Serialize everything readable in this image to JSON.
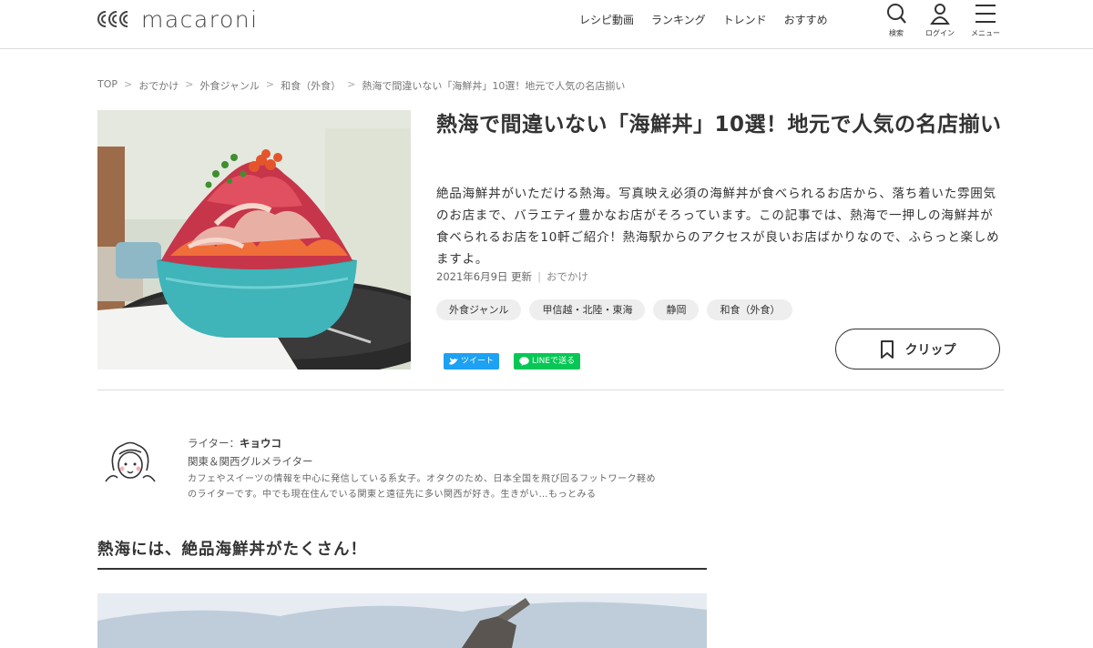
{
  "header": {
    "logo_text": "macaroni",
    "nav": [
      "レシピ動画",
      "ランキング",
      "トレンド",
      "おすすめ"
    ],
    "tools": {
      "search": "検索",
      "login": "ログイン",
      "menu": "メニュー"
    }
  },
  "breadcrumb": [
    "TOP",
    "おでかけ",
    "外食ジャンル",
    "和食（外食）",
    "熱海で間違いない「海鮮丼」10選！地元で人気の名店揃い"
  ],
  "article": {
    "title": "熱海で間違いない「海鮮丼」10選！地元で人気の名店揃い",
    "description": "絶品海鮮丼がいただける熱海。写真映え必須の海鮮丼が食べられるお店から、落ち着いた雰囲気のお店まで、バラエティ豊かなお店がそろっています。この記事では、熱海で一押しの海鮮丼が食べられるお店を10軒ご紹介！熱海駅からのアクセスが良いお店ばかりなので、ふらっと楽しめますよ。",
    "date": "2021年6月9日 更新",
    "category": "おでかけ",
    "tags": [
      "外食ジャンル",
      "甲信越・北陸・東海",
      "静岡",
      "和食（外食）"
    ],
    "clip_label": "クリップ",
    "tweet_label": "ツイート",
    "line_label": "LINEで送る"
  },
  "writer": {
    "label": "ライター：",
    "name": "キョウコ",
    "role": "関東＆関西グルメライター",
    "bio_line1": "カフェやスイーツの情報を中心に発信している系女子。オタクのため、日本全国を飛び回るフットワーク軽め",
    "bio_line2": "のライターです。中でも現在住んでいる関東と遠征先に多い関西が好き。生きがい…",
    "more": "もっとみる"
  },
  "section_heading": "熱海には、絶品海鮮丼がたくさん！",
  "colors": {
    "twitter": "#1da1f2",
    "line": "#06c755",
    "bowl": "#3fb4b9"
  }
}
